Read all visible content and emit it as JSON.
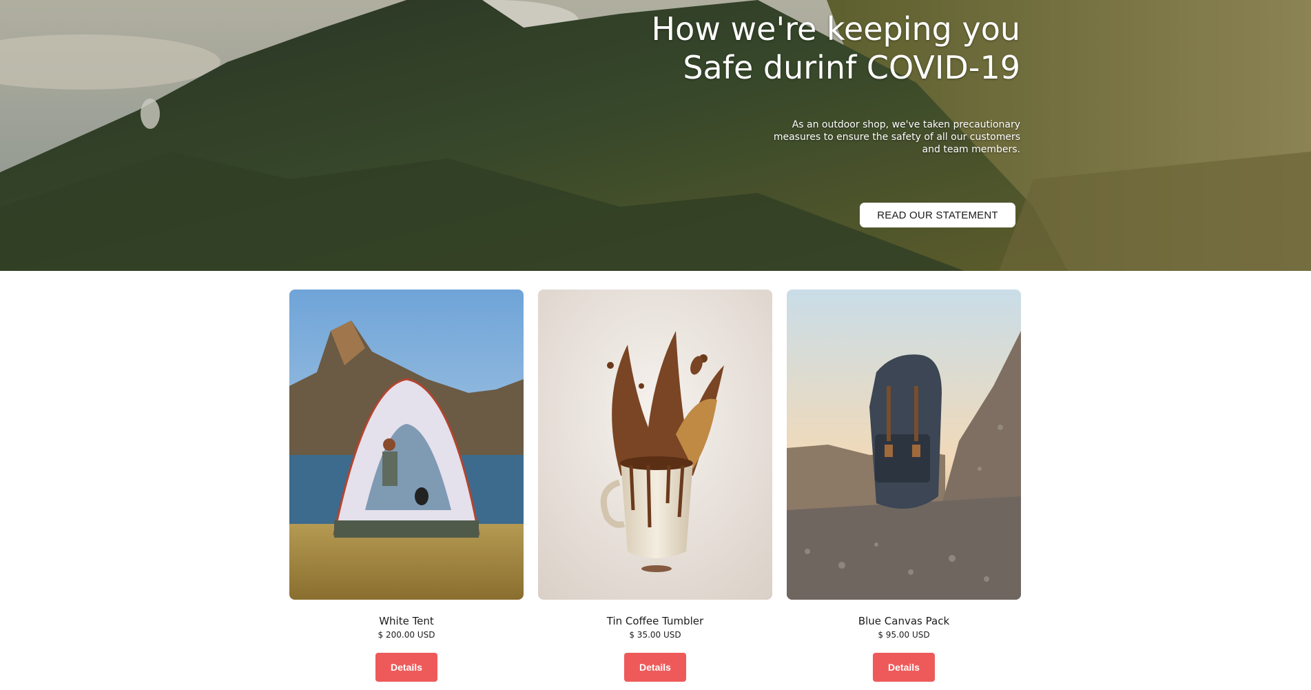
{
  "hero": {
    "title_line1": "How we're keeping you",
    "title_line2": "Safe durinf COVID-19",
    "subtitle": "As an outdoor shop, we've taken precautionary measures to ensure the safety of all our customers and team members.",
    "button_label": "READ OUR STATEMENT",
    "image": "mountain-landscape"
  },
  "products": [
    {
      "name": "White Tent",
      "price": "$ 200.00 USD",
      "button_label": "Details",
      "image": "tent-by-lake"
    },
    {
      "name": "Tin Coffee Tumbler",
      "price": "$ 35.00 USD",
      "button_label": "Details",
      "image": "coffee-splash-mug"
    },
    {
      "name": "Blue Canvas Pack",
      "price": "$ 95.00 USD",
      "button_label": "Details",
      "image": "backpack-on-rocks"
    }
  ],
  "colors": {
    "details_button": "#ee5a5a",
    "hero_button_bg": "#ffffff",
    "text": "#1b1b1b"
  }
}
